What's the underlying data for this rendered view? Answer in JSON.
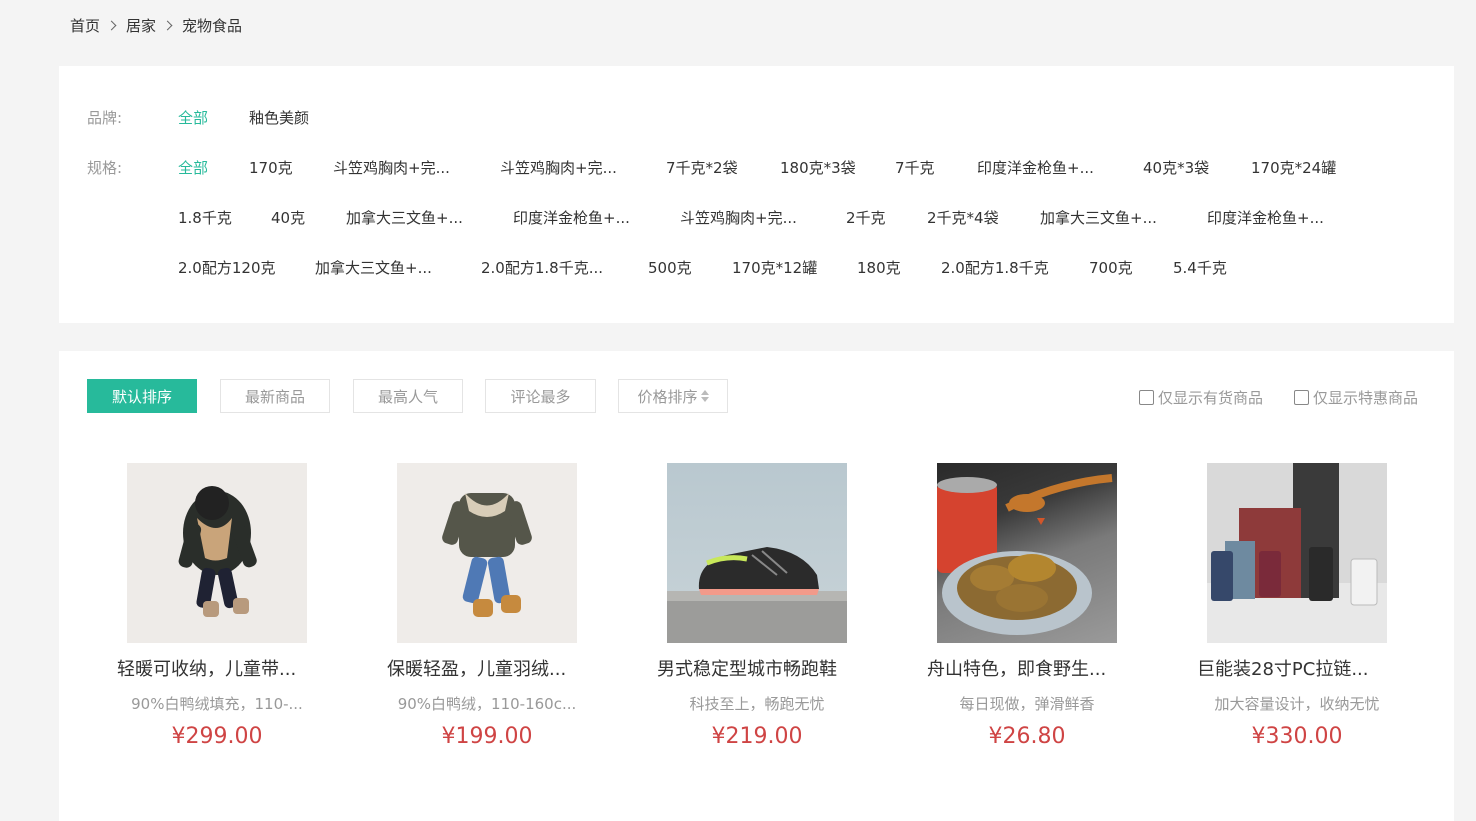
{
  "breadcrumb": [
    "首页",
    "居家",
    "宠物食品"
  ],
  "filters": {
    "brand_label": "品牌:",
    "brand_options": [
      "全部",
      "釉色美颜"
    ],
    "spec_label": "规格:",
    "spec_rows": [
      [
        "全部",
        "170克",
        "斗笠鸡胸肉+完...",
        "斗笠鸡胸肉+完...",
        "7千克*2袋",
        "180克*3袋",
        "7千克",
        "印度洋金枪鱼+...",
        "40克*3袋",
        "170克*24罐"
      ],
      [
        "1.8千克",
        "40克",
        "加拿大三文鱼+...",
        "印度洋金枪鱼+...",
        "斗笠鸡胸肉+完...",
        "2千克",
        "2千克*4袋",
        "加拿大三文鱼+...",
        "印度洋金枪鱼+..."
      ],
      [
        "2.0配方120克",
        "加拿大三文鱼+...",
        "2.0配方1.8千克...",
        "500克",
        "170克*12罐",
        "180克",
        "2.0配方1.8千克",
        "700克",
        "5.4千克"
      ]
    ]
  },
  "sort": {
    "default": "默认排序",
    "newest": "最新商品",
    "popular": "最高人气",
    "comments": "评论最多",
    "price": "价格排序"
  },
  "checks": {
    "in_stock": "仅显示有货商品",
    "on_sale": "仅显示特惠商品"
  },
  "goods": [
    {
      "name": "轻暖可收纳，儿童带...",
      "desc": "90%白鸭绒填充，110-...",
      "price": "¥299.00"
    },
    {
      "name": "保暖轻盈，儿童羽绒...",
      "desc": "90%白鸭绒，110-160c...",
      "price": "¥199.00"
    },
    {
      "name": "男式稳定型城市畅跑鞋",
      "desc": "科技至上，畅跑无忧",
      "price": "¥219.00"
    },
    {
      "name": "舟山特色，即食野生...",
      "desc": "每日现做，弹滑鲜香",
      "price": "¥26.80"
    },
    {
      "name": "巨能装28寸PC拉链...",
      "desc": "加大容量设计，收纳无忧",
      "price": "¥330.00"
    }
  ],
  "colors": {
    "accent": "#27ba9b",
    "price": "#cf4444"
  }
}
